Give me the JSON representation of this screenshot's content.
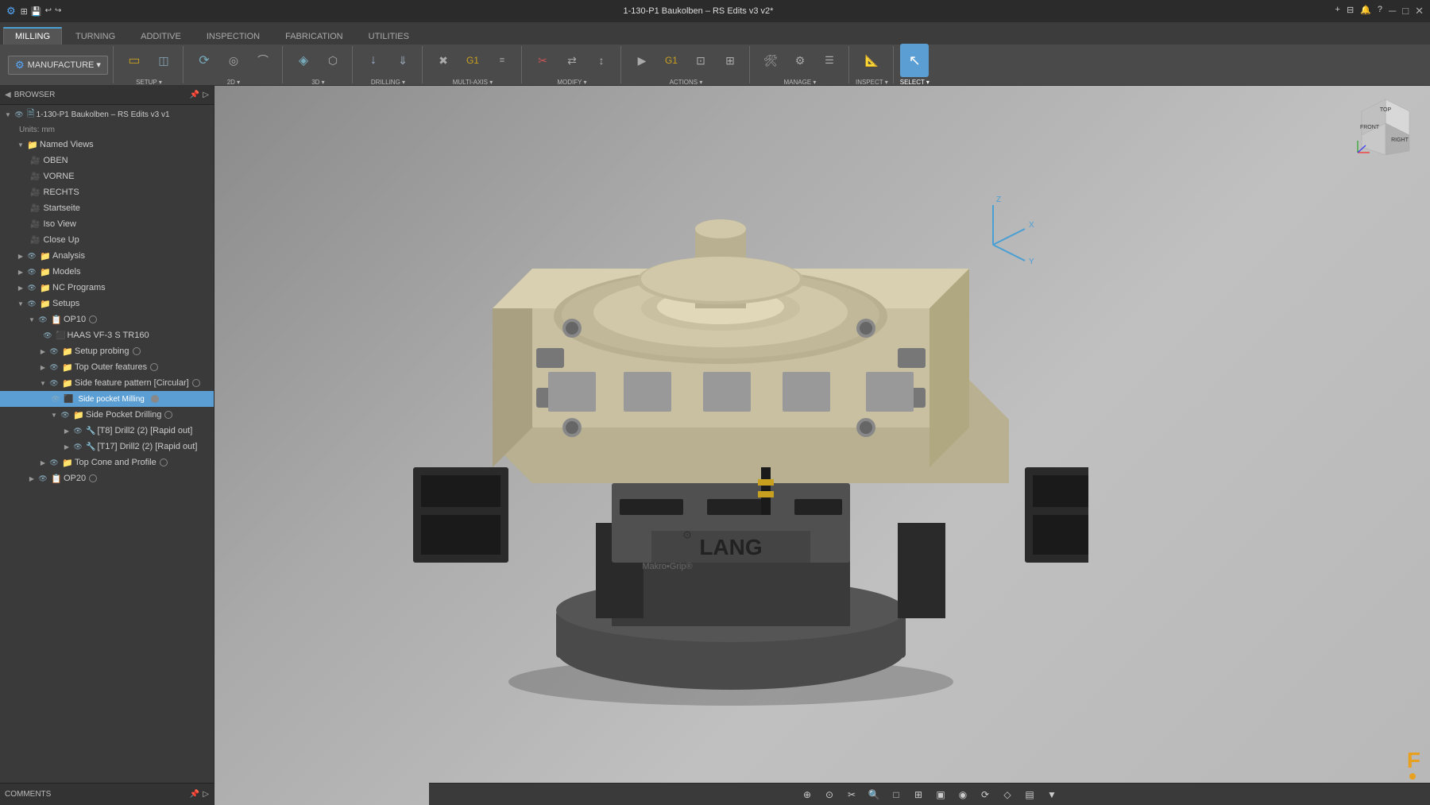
{
  "titlebar": {
    "title": "1-130-P1 Baukolben – RS Edits v3 v2*",
    "close_btn": "✕",
    "min_btn": "─",
    "max_btn": "□",
    "new_btn": "+"
  },
  "tabs": [
    {
      "label": "MILLING",
      "active": true
    },
    {
      "label": "TURNING",
      "active": false
    },
    {
      "label": "ADDITIVE",
      "active": false
    },
    {
      "label": "INSPECTION",
      "active": false
    },
    {
      "label": "FABRICATION",
      "active": false
    },
    {
      "label": "UTILITIES",
      "active": false
    }
  ],
  "manufacture_btn": "MANUFACTURE ▾",
  "toolbar_sections": {
    "setup": {
      "label": "SETUP ▾",
      "buttons": [
        "setup1",
        "setup2"
      ]
    },
    "view2d": {
      "label": "2D ▾"
    },
    "view3d": {
      "label": "3D ▾"
    },
    "drilling": {
      "label": "DRILLING ▾"
    },
    "multiaxis": {
      "label": "MULTI-AXIS ▾"
    },
    "modify": {
      "label": "MODIFY ▾"
    },
    "actions": {
      "label": "ACTIONS ▾"
    },
    "manage": {
      "label": "MANAGE ▾"
    },
    "inspect": {
      "label": "INSPECT ▾"
    },
    "select": {
      "label": "SELECT ▾"
    }
  },
  "browser": {
    "header": "BROWSER",
    "tree": [
      {
        "id": "root",
        "label": "1-130-P1 Baukolben – RS Edits v3 v1",
        "indent": 0,
        "expanded": true,
        "type": "doc"
      },
      {
        "id": "units",
        "label": "Units: mm",
        "indent": 1,
        "type": "units"
      },
      {
        "id": "namedviews",
        "label": "Named Views",
        "indent": 1,
        "expanded": true,
        "type": "folder"
      },
      {
        "id": "oben",
        "label": "OBEN",
        "indent": 2,
        "type": "view"
      },
      {
        "id": "vorne",
        "label": "VORNE",
        "indent": 2,
        "type": "view"
      },
      {
        "id": "rechts",
        "label": "RECHTS",
        "indent": 2,
        "type": "view"
      },
      {
        "id": "startseite",
        "label": "Startseite",
        "indent": 2,
        "type": "view"
      },
      {
        "id": "isoview",
        "label": "Iso View",
        "indent": 2,
        "type": "view"
      },
      {
        "id": "closeup",
        "label": "Close Up",
        "indent": 2,
        "type": "view"
      },
      {
        "id": "analysis",
        "label": "Analysis",
        "indent": 1,
        "expanded": false,
        "type": "folder"
      },
      {
        "id": "models",
        "label": "Models",
        "indent": 1,
        "expanded": false,
        "type": "folder"
      },
      {
        "id": "ncprograms",
        "label": "NC Programs",
        "indent": 1,
        "expanded": false,
        "type": "folder"
      },
      {
        "id": "setups",
        "label": "Setups",
        "indent": 1,
        "expanded": true,
        "type": "folder"
      },
      {
        "id": "op10",
        "label": "OP10",
        "indent": 2,
        "expanded": true,
        "type": "setup",
        "has_circle": true
      },
      {
        "id": "haas",
        "label": "HAAS VF-3 S TR160",
        "indent": 3,
        "type": "machine"
      },
      {
        "id": "setupprobing",
        "label": "Setup probing",
        "indent": 3,
        "expanded": false,
        "type": "folder",
        "has_circle": true
      },
      {
        "id": "topouterfeatures",
        "label": "Top Outer features",
        "indent": 3,
        "expanded": false,
        "type": "folder",
        "has_circle": true
      },
      {
        "id": "sidefeature",
        "label": "Side feature pattern [Circular]",
        "indent": 3,
        "expanded": true,
        "type": "folder",
        "has_circle": true
      },
      {
        "id": "sidepocket",
        "label": "Side pocket Milling",
        "indent": 4,
        "type": "operation",
        "highlighted": true,
        "has_circle": true
      },
      {
        "id": "sidepocketdrilling",
        "label": "Side Pocket Drilling",
        "indent": 4,
        "expanded": true,
        "type": "folder",
        "has_circle": true
      },
      {
        "id": "tb8drill",
        "label": "[T8] Drill2 (2) [Rapid out]",
        "indent": 5,
        "type": "tool"
      },
      {
        "id": "t17drill",
        "label": "[T17] Drill2 (2) [Rapid out]",
        "indent": 5,
        "type": "tool"
      },
      {
        "id": "topconeprofile",
        "label": "Top Cone and Profile",
        "indent": 3,
        "expanded": false,
        "type": "folder",
        "has_circle": true
      },
      {
        "id": "op20",
        "label": "OP20",
        "indent": 2,
        "expanded": false,
        "type": "setup",
        "has_circle": true
      }
    ]
  },
  "comments": {
    "label": "COMMENTS"
  },
  "viewport": {
    "model_label": "LANG Makro-Grip"
  },
  "bottom_toolbar_icons": [
    "⊕",
    "⊙",
    "✂",
    "🔍",
    "□",
    "⊞",
    "▣",
    "◉",
    "⟳",
    "◇",
    "▤",
    "▼"
  ]
}
